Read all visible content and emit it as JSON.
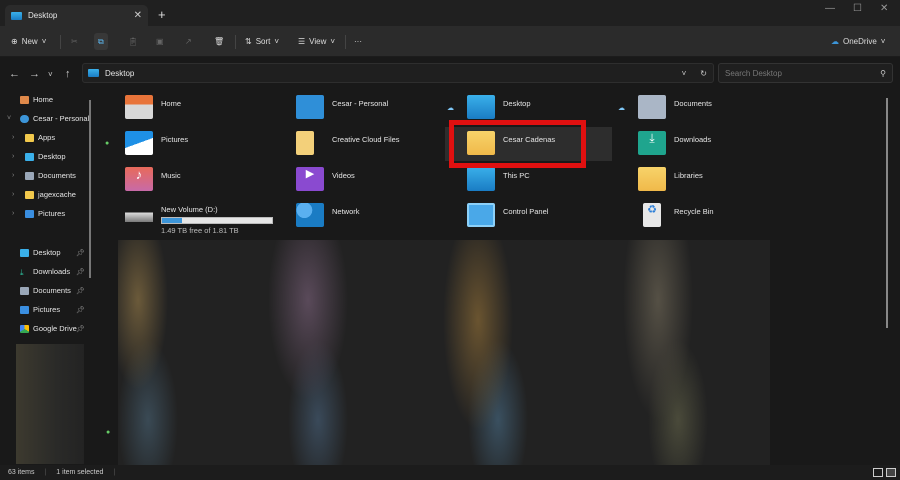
{
  "window": {
    "tab_title": "Desktop",
    "new_tab": "+",
    "minimize": "—",
    "maximize": "☐",
    "close": "✕"
  },
  "toolbar": {
    "new": "New",
    "sort": "Sort",
    "view": "View",
    "more": "···",
    "onedrive": "OneDrive"
  },
  "address": {
    "path": "Desktop",
    "search_placeholder": "Search Desktop"
  },
  "sidebar": {
    "top": [
      {
        "label": "Home"
      },
      {
        "label": "Cesar - Personal"
      },
      {
        "label": "Apps"
      },
      {
        "label": "Desktop"
      },
      {
        "label": "Documents"
      },
      {
        "label": "jagexcache"
      },
      {
        "label": "Pictures"
      }
    ],
    "pinned": [
      {
        "label": "Desktop"
      },
      {
        "label": "Downloads"
      },
      {
        "label": "Documents"
      },
      {
        "label": "Pictures"
      },
      {
        "label": "Google Drive"
      }
    ]
  },
  "items": [
    {
      "label": "Home"
    },
    {
      "label": "Cesar - Personal"
    },
    {
      "label": "Desktop"
    },
    {
      "label": "Documents"
    },
    {
      "label": "Pictures"
    },
    {
      "label": "Creative Cloud Files"
    },
    {
      "label": "Cesar Cadenas"
    },
    {
      "label": "Downloads"
    },
    {
      "label": "Music"
    },
    {
      "label": "Videos"
    },
    {
      "label": "This PC"
    },
    {
      "label": "Libraries"
    },
    {
      "label": "New Volume (D:)",
      "detail": "1.49 TB free of 1.81 TB",
      "used_fraction": 0.18
    },
    {
      "label": "Network"
    },
    {
      "label": "Control Panel"
    },
    {
      "label": "Recycle Bin"
    }
  ],
  "status": {
    "count": "63 items",
    "selected": "1 item selected"
  },
  "colors": {
    "highlight": "#e01010",
    "accent": "#3c95d8"
  }
}
